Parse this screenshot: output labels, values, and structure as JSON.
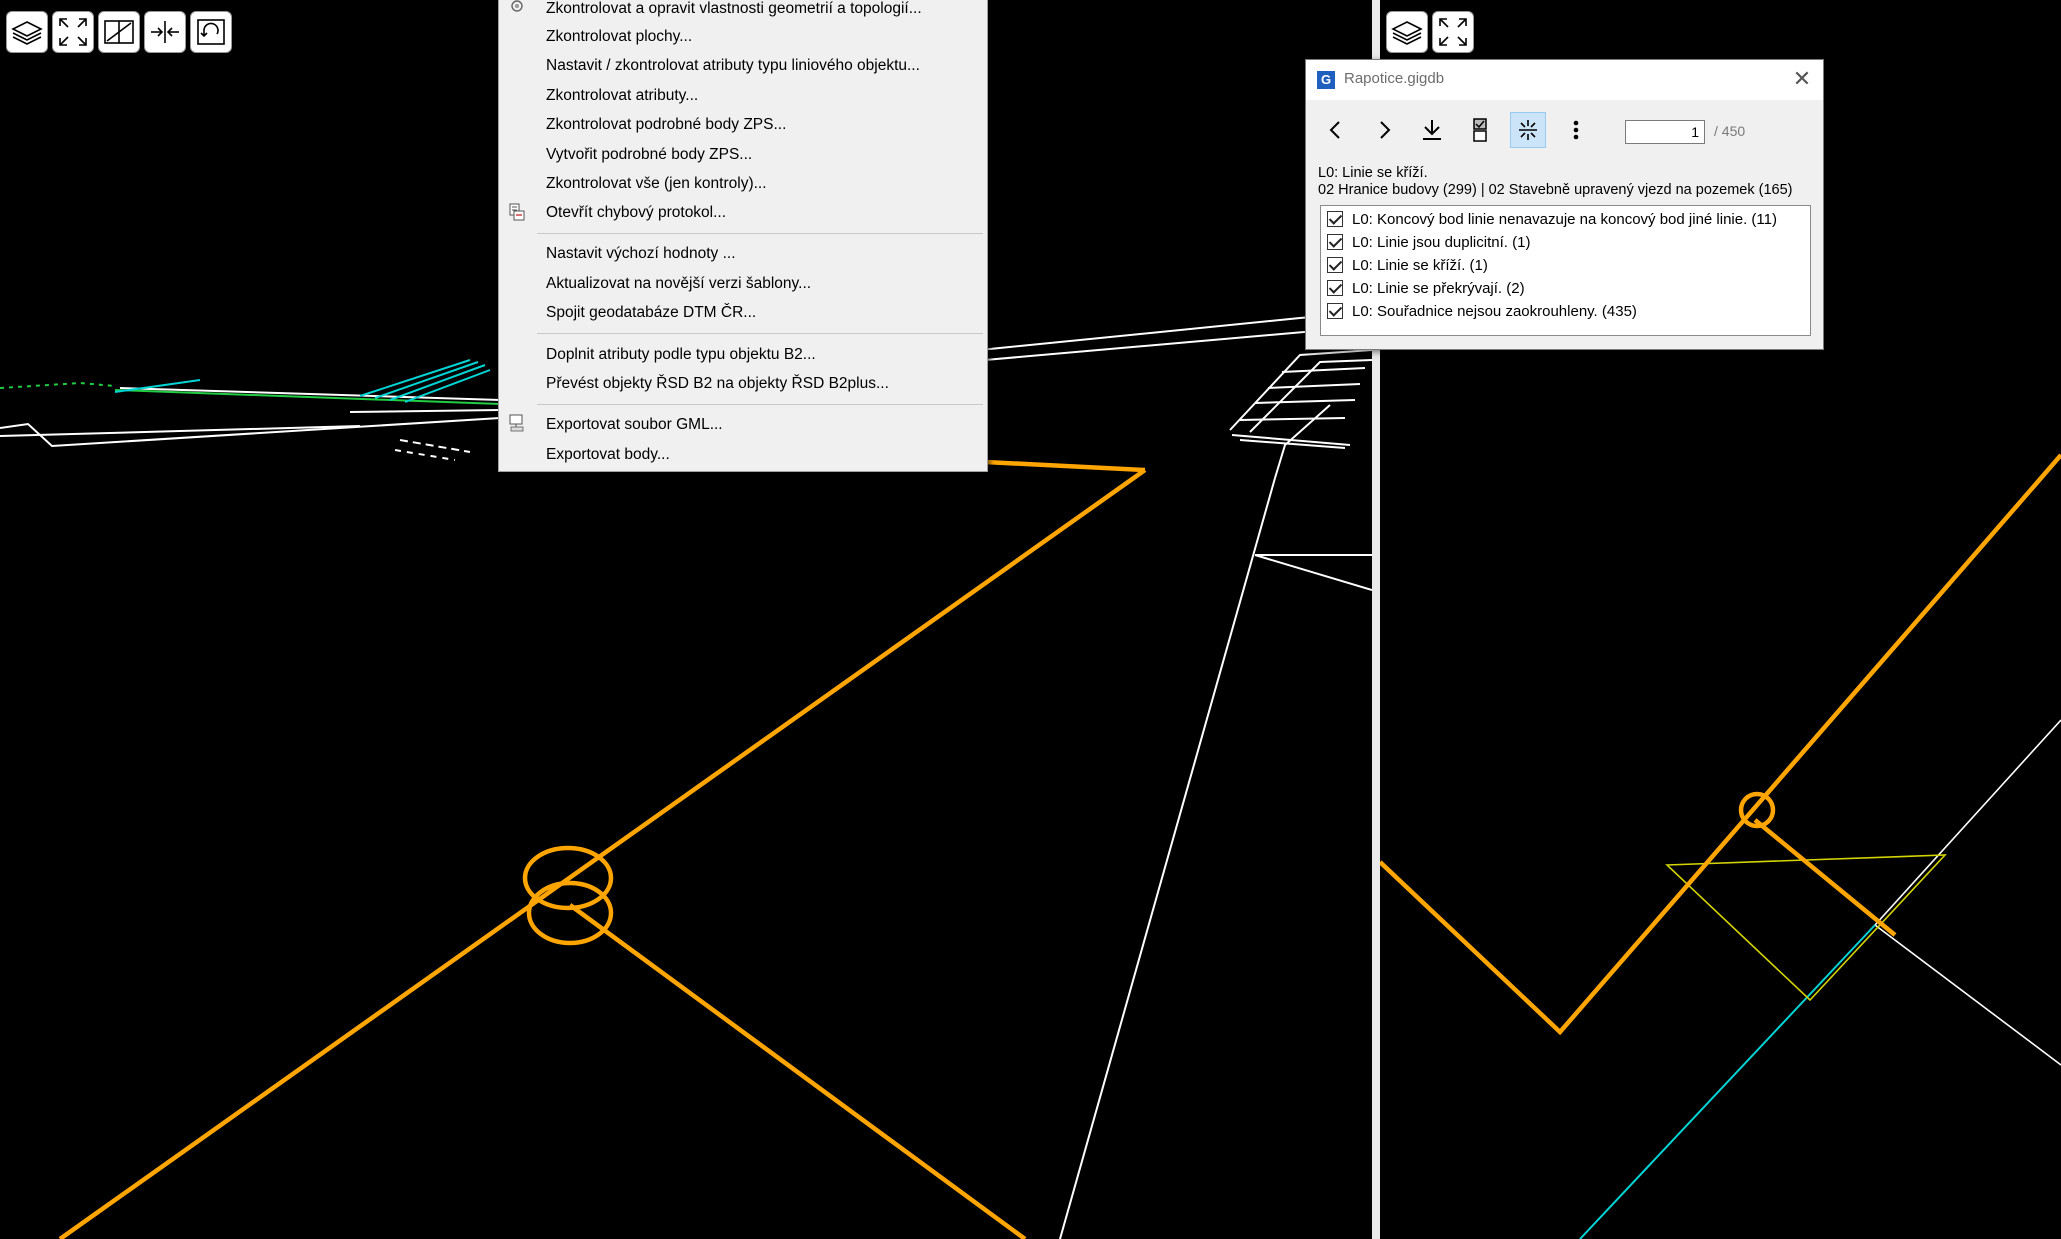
{
  "context_menu": {
    "items": [
      {
        "label": "Zkontrolovat a opravit vlastnosti geometrií a topologií...",
        "icon": "gear-check-icon"
      },
      {
        "label": "Zkontrolovat plochy..."
      },
      {
        "label": "Nastavit / zkontrolovat atributy typu liniového objektu..."
      },
      {
        "label": "Zkontrolovat atributy..."
      },
      {
        "label": "Zkontrolovat podrobné body ZPS..."
      },
      {
        "label": "Vytvořit podrobné body ZPS..."
      },
      {
        "label": "Zkontrolovat vše (jen kontroly)..."
      },
      {
        "label": "Otevřít chybový protokol...",
        "icon": "error-log-icon"
      },
      {
        "label": "Nastavit výchozí hodnoty ..."
      },
      {
        "label": "Aktualizovat na novější verzi šablony..."
      },
      {
        "label": "Spojit geodatabáze DTM ČR..."
      },
      {
        "label": "Doplnit atributy podle typu objektu B2..."
      },
      {
        "label": "Převést objekty ŘSD B2 na objekty ŘSD B2plus..."
      },
      {
        "label": "Exportovat soubor GML...",
        "icon": "gml-export-icon"
      },
      {
        "label": "Exportovat body..."
      }
    ]
  },
  "dialog": {
    "app_icon": "G",
    "title": "Rapotice.gigdb",
    "close": "✕",
    "page_value": "1",
    "page_total": "/ 450",
    "error_title": "L0: Linie se kříží.",
    "error_objects": "02 Hranice budovy (299) | 02 Stavebně upravený vjezd na pozemek (165)",
    "checks": [
      {
        "label": "L0: Koncový bod linie nenavazuje na koncový bod jiné linie. (11)",
        "checked": true
      },
      {
        "label": "L0: Linie jsou duplicitní. (1)",
        "checked": true
      },
      {
        "label": "L0: Linie se kříží. (1)",
        "checked": true
      },
      {
        "label": "L0: Linie se překrývají. (2)",
        "checked": true
      },
      {
        "label": "L0: Souřadnice nejsou zaokrouhleny. (435)",
        "checked": true
      }
    ]
  },
  "colors": {
    "highlight": "#ffa500",
    "line_white": "#ffffff",
    "line_cyan": "#00d4d4",
    "line_green": "#22cc44",
    "line_yellow": "#d4d400"
  }
}
